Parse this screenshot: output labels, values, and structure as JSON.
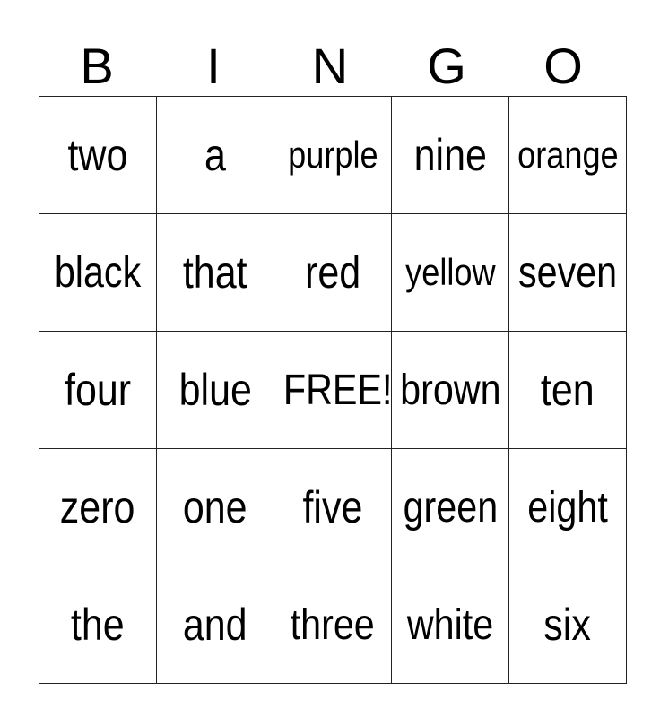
{
  "header": [
    "B",
    "I",
    "N",
    "G",
    "O"
  ],
  "card": {
    "rows": [
      [
        "two",
        "a",
        "purple",
        "nine",
        "orange"
      ],
      [
        "black",
        "that",
        "red",
        "yellow",
        "seven"
      ],
      [
        "four",
        "blue",
        "FREE!",
        "brown",
        "ten"
      ],
      [
        "zero",
        "one",
        "five",
        "green",
        "eight"
      ],
      [
        "the",
        "and",
        "three",
        "white",
        "six"
      ]
    ],
    "free_space": "FREE!"
  }
}
